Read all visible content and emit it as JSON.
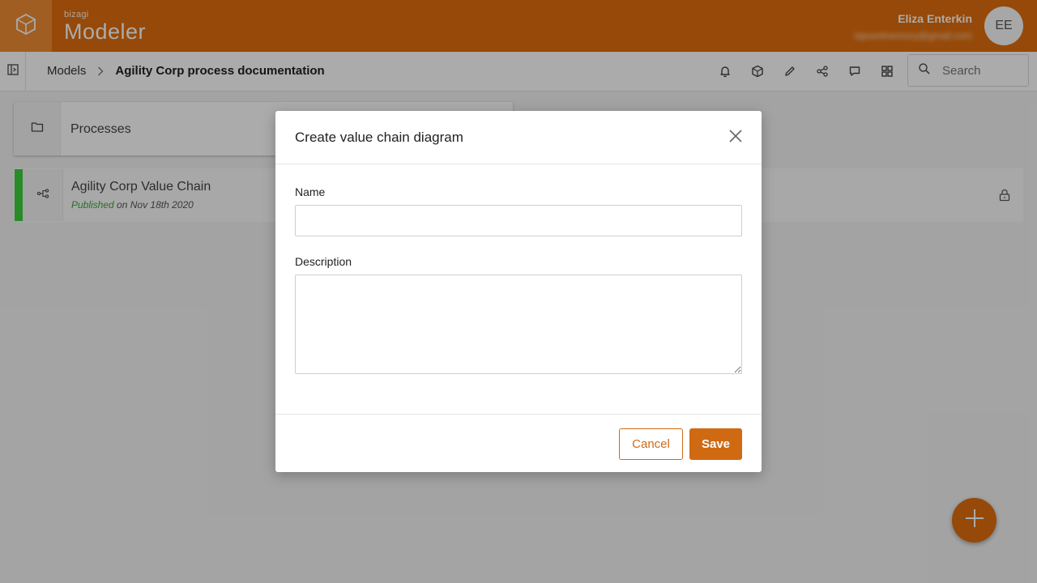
{
  "header": {
    "brand_small": "bizagi",
    "brand_name": "Modeler",
    "user_name": "Eliza Enterkin",
    "user_email": "lapsedmemory@gmail.com",
    "avatar_initials": "EE",
    "accent_color": "#e06e0c"
  },
  "toolbar": {
    "breadcrumb_root": "Models",
    "breadcrumb_current": "Agility Corp process documentation",
    "icons": [
      "notifications-icon",
      "publish-icon",
      "edit-icon",
      "share-icon",
      "comments-icon",
      "grid-view-icon"
    ],
    "search_placeholder": "Search"
  },
  "content": {
    "folder_label": "Processes",
    "model": {
      "title": "Agility Corp Value Chain",
      "status": "Published",
      "date_text": " on Nov 18th 2020",
      "status_color": "#3cd03c"
    }
  },
  "modal": {
    "title": "Create value chain diagram",
    "name_label": "Name",
    "name_value": "",
    "description_label": "Description",
    "description_value": "",
    "cancel_label": "Cancel",
    "save_label": "Save"
  }
}
